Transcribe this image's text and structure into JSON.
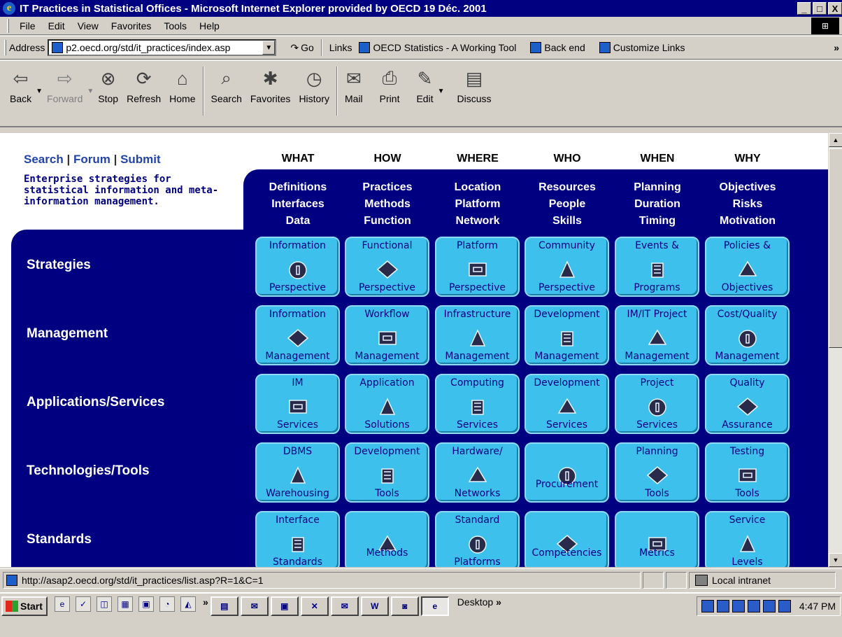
{
  "window": {
    "title": "IT Practices in Statistical Offices - Microsoft Internet Explorer provided by OECD 19 Déc. 2001",
    "controls": [
      "_",
      "□",
      "X"
    ]
  },
  "menu": [
    "File",
    "Edit",
    "View",
    "Favorites",
    "Tools",
    "Help"
  ],
  "address": {
    "label": "Address",
    "value": "p2.oecd.org/std/it_practices/index.asp",
    "go": "Go",
    "links_label": "Links",
    "links": [
      "OECD Statistics - A Working Tool",
      "Back end",
      "Customize Links"
    ],
    "overflow": "»"
  },
  "toolbar": [
    {
      "label": "Back",
      "icon": "back-arrow-icon",
      "enabled": true
    },
    {
      "label": "Forward",
      "icon": "forward-arrow-icon",
      "enabled": false
    },
    {
      "label": "Stop",
      "icon": "stop-icon",
      "enabled": true
    },
    {
      "label": "Refresh",
      "icon": "refresh-icon",
      "enabled": true
    },
    {
      "label": "Home",
      "icon": "home-icon",
      "enabled": true
    },
    {
      "label": "Search",
      "icon": "search-icon",
      "enabled": true
    },
    {
      "label": "Favorites",
      "icon": "favorites-icon",
      "enabled": true
    },
    {
      "label": "History",
      "icon": "history-icon",
      "enabled": true
    },
    {
      "label": "Mail",
      "icon": "mail-icon",
      "enabled": true
    },
    {
      "label": "Print",
      "icon": "print-icon",
      "enabled": true
    },
    {
      "label": "Edit",
      "icon": "edit-icon",
      "enabled": true
    },
    {
      "label": "Discuss",
      "icon": "discuss-icon",
      "enabled": true
    }
  ],
  "page": {
    "nav": {
      "search": "Search",
      "sep": "|",
      "forum": "Forum",
      "submit": "Submit"
    },
    "tagline": "Enterprise strategies for statistical information and meta-information management.",
    "columns": [
      {
        "head": "WHAT",
        "sub": "Definitions\nInterfaces\nData"
      },
      {
        "head": "HOW",
        "sub": "Practices\nMethods\nFunction"
      },
      {
        "head": "WHERE",
        "sub": "Location\nPlatform\nNetwork"
      },
      {
        "head": "WHO",
        "sub": "Resources\nPeople\nSkills"
      },
      {
        "head": "WHEN",
        "sub": "Planning\nDuration\nTiming"
      },
      {
        "head": "WHY",
        "sub": "Objectives\nRisks\nMotivation"
      }
    ],
    "rows": [
      {
        "label": "Strategies",
        "tiles": [
          {
            "top": "Information",
            "bottom": "Perspective"
          },
          {
            "top": "Functional",
            "bottom": "Perspective"
          },
          {
            "top": "Platform",
            "bottom": "Perspective"
          },
          {
            "top": "Community",
            "bottom": "Perspective"
          },
          {
            "top": "Events &",
            "bottom": "Programs"
          },
          {
            "top": "Policies &",
            "bottom": "Objectives"
          }
        ]
      },
      {
        "label": "Management",
        "tiles": [
          {
            "top": "Information",
            "bottom": "Management"
          },
          {
            "top": "Workflow",
            "bottom": "Management"
          },
          {
            "top": "Infrastructure",
            "bottom": "Management"
          },
          {
            "top": "Development",
            "bottom": "Management"
          },
          {
            "top": "IM/IT Project",
            "bottom": "Management"
          },
          {
            "top": "Cost/Quality",
            "bottom": "Management"
          }
        ]
      },
      {
        "label": "Applications/Services",
        "tiles": [
          {
            "top": "IM",
            "bottom": "Services"
          },
          {
            "top": "Application",
            "bottom": "Solutions"
          },
          {
            "top": "Computing",
            "bottom": "Services"
          },
          {
            "top": "Development",
            "bottom": "Services"
          },
          {
            "top": "Project",
            "bottom": "Services"
          },
          {
            "top": "Quality",
            "bottom": "Assurance"
          }
        ]
      },
      {
        "label": "Technologies/Tools",
        "tiles": [
          {
            "top": "DBMS",
            "bottom": "Warehousing"
          },
          {
            "top": "Development",
            "bottom": "Tools"
          },
          {
            "top": "Hardware/",
            "bottom": "Networks"
          },
          {
            "top": "",
            "bottom": "Procurement"
          },
          {
            "top": "Planning",
            "bottom": "Tools"
          },
          {
            "top": "Testing",
            "bottom": "Tools"
          }
        ]
      },
      {
        "label": "Standards",
        "tiles": [
          {
            "top": "Interface",
            "bottom": "Standards"
          },
          {
            "top": "",
            "bottom": "Methods"
          },
          {
            "top": "Standard",
            "bottom": "Platforms"
          },
          {
            "top": "",
            "bottom": "Competencies"
          },
          {
            "top": "",
            "bottom": "Metrics"
          },
          {
            "top": "Service",
            "bottom": "Levels"
          }
        ]
      }
    ]
  },
  "status": {
    "url": "http://asap2.oecd.org/std/it_practices/list.asp?R=1&C=1",
    "zone": "Local intranet"
  },
  "taskbar": {
    "start": "Start",
    "desktop": "Desktop",
    "overflow": "»",
    "time": "4:47 PM"
  }
}
